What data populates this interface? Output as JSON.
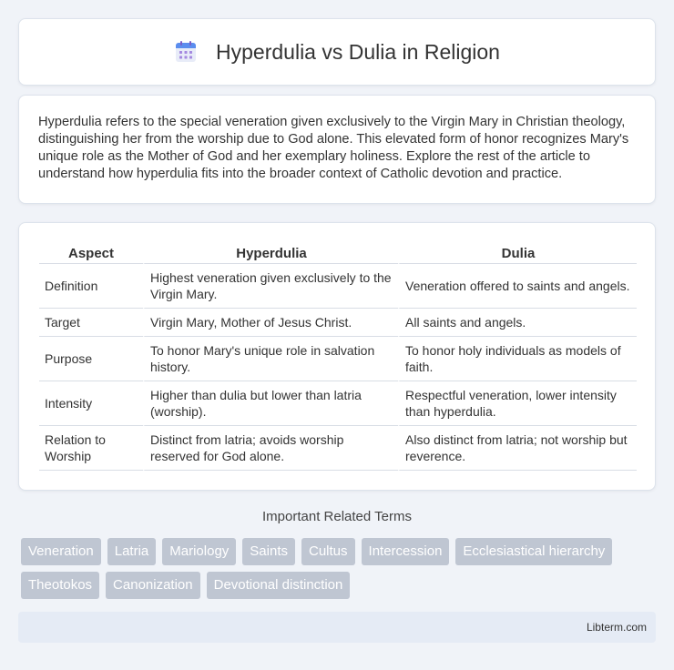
{
  "header": {
    "title": "Hyperdulia vs Dulia in Religion",
    "icon": "calendar-icon"
  },
  "intro": {
    "text": "Hyperdulia refers to the special veneration given exclusively to the Virgin Mary in Christian theology, distinguishing her from the worship due to God alone. This elevated form of honor recognizes Mary's unique role as the Mother of God and her exemplary holiness. Explore the rest of the article to understand how hyperdulia fits into the broader context of Catholic devotion and practice."
  },
  "table": {
    "headers": [
      "Aspect",
      "Hyperdulia",
      "Dulia"
    ],
    "rows": [
      [
        "Definition",
        "Highest veneration given exclusively to the Virgin Mary.",
        "Veneration offered to saints and angels."
      ],
      [
        "Target",
        "Virgin Mary, Mother of Jesus Christ.",
        "All saints and angels."
      ],
      [
        "Purpose",
        "To honor Mary's unique role in salvation history.",
        "To honor holy individuals as models of faith."
      ],
      [
        "Intensity",
        "Higher than dulia but lower than latria (worship).",
        "Respectful veneration, lower intensity than hyperdulia."
      ],
      [
        "Relation to Worship",
        "Distinct from latria; avoids worship reserved for God alone.",
        "Also distinct from latria; not worship but reverence."
      ]
    ]
  },
  "related": {
    "title": "Important Related Terms",
    "tags": [
      "Veneration",
      "Latria",
      "Mariology",
      "Saints",
      "Cultus",
      "Intercession",
      "Ecclesiastical hierarchy",
      "Theotokos",
      "Canonization",
      "Devotional distinction"
    ]
  },
  "footer": {
    "text": "Libterm.com"
  },
  "colors": {
    "background": "#f0f3f8",
    "tag": "#bfc6d2",
    "footer": "#e5ebf5"
  }
}
